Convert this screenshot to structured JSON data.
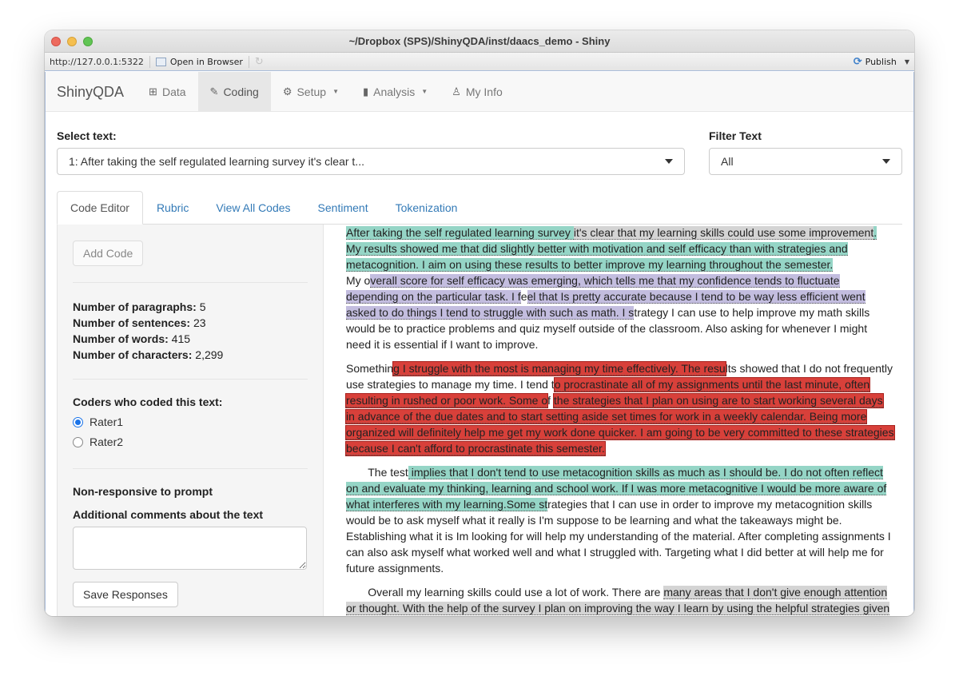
{
  "window": {
    "title": "~/Dropbox (SPS)/ShinyQDA/inst/daacs_demo - Shiny"
  },
  "rstudio_bar": {
    "url": "http://127.0.0.1:5322",
    "open_in_browser": "Open in Browser",
    "publish": "Publish"
  },
  "navbar": {
    "brand": "ShinyQDA",
    "items": [
      {
        "label": "Data",
        "icon": "table-icon",
        "glyph": "⊞"
      },
      {
        "label": "Coding",
        "icon": "edit-icon",
        "glyph": "✎",
        "active": true
      },
      {
        "label": "Setup",
        "icon": "gears-icon",
        "glyph": "⚙",
        "dropdown": true
      },
      {
        "label": "Analysis",
        "icon": "bar-chart-icon",
        "glyph": "▮",
        "dropdown": true
      },
      {
        "label": "My Info",
        "icon": "user-icon",
        "glyph": "♙"
      }
    ]
  },
  "select_text": {
    "label": "Select text:",
    "value": "1: After taking the self regulated learning survey it's clear t..."
  },
  "filter_text": {
    "label": "Filter Text",
    "value": "All"
  },
  "tabs": [
    "Code Editor",
    "Rubric",
    "View All Codes",
    "Sentiment",
    "Tokenization"
  ],
  "sidebar": {
    "add_code": "Add Code",
    "stats": [
      {
        "label": "Number of paragraphs:",
        "value": "5"
      },
      {
        "label": "Number of sentences:",
        "value": "23"
      },
      {
        "label": "Number of words:",
        "value": "415"
      },
      {
        "label": "Number of characters:",
        "value": "2,299"
      }
    ],
    "coders_label": "Coders who coded this text:",
    "coders": [
      {
        "label": "Rater1",
        "checked": true
      },
      {
        "label": "Rater2",
        "checked": false
      }
    ],
    "non_responsive": "Non-responsive to prompt",
    "comments_label": "Additional comments about the text",
    "comments_value": "",
    "save": "Save Responses"
  },
  "colors": {
    "teal": "#95d5c6",
    "purple": "#c3bddf",
    "red": "#d8403a",
    "gray": "#d4d4d4",
    "link": "#337ab7"
  },
  "document": {
    "paragraphs": [
      [
        {
          "t": "After taking the self regulated learning survey ",
          "c": "teal"
        },
        {
          "t": "it's clear that my learning skills could use some improvement",
          "c": "gray"
        },
        {
          "t": ". My results showed me that did slightly better with motivation and self efficacy than with strategies and metacognition. I aim on using these results to better improve my learning throughout the semester.",
          "c": "teal"
        },
        {
          "br": true
        },
        {
          "t": " My o"
        },
        {
          "t": "verall score for self efficacy was emerging, which tells me that my confidence tends to fluctuate depending on the particular task. I f",
          "c": "purple"
        },
        {
          "t": "e"
        },
        {
          "t": "el that Is pretty accurate because I tend to be way less efficient went asked to do things I tend to struggle with such as math. I s",
          "c": "purple"
        },
        {
          "t": "trategy I can use to help improve my math skills would be to practice problems and quiz myself outside of the classroom. Also asking for whenever I might need it is essential if I want to improve."
        }
      ],
      [
        {
          "t": " Somethin"
        },
        {
          "t": "g I struggle with the most is managing my time effectively. The resu",
          "c": "red"
        },
        {
          "t": "lts showed that I do not frequently use strategies to manage my time. I tend t"
        },
        {
          "t": "o procrastinate all of my assignments until the last minute, often resulting in rushed or poor work. Some o",
          "c": "red"
        },
        {
          "t": "f "
        },
        {
          "t": "the strategies that I plan on using are to start working several days in advance of the due dates and to start setting aside set times for work in a weekly calendar. Being more organized will definitely help me get my work done quicker. I am going to be very committed to these strategies because I can't afford to procrastinate this semester.",
          "c": "red"
        }
      ],
      [
        {
          "t": "       The test"
        },
        {
          "t": " implies that I don't tend to use metacognition skills as much as I should be. I do not often reflect on and evaluate my thinking, learning and school work. If I was more metacognitive I would be more aware of what interferes with my learning.Some st",
          "c": "teal"
        },
        {
          "t": "rategies that I can use in order to improve my metacognition skills would be to ask myself what it really is I'm suppose to be learning and what the takeaways might be. Establishing what it is Im looking for will help my understanding of the material. After completing assignments I can also ask myself what worked well and what I struggled with. Targeting what I did better at will help me for future assignments."
        }
      ],
      [
        {
          "t": "       Overall my learning skills could use a lot of work. There are "
        },
        {
          "t": "many areas that I don't give enough attention or thought. With the help of the survey I plan on improving the way I learn by using the helpful strategies given",
          "c": "gray"
        }
      ]
    ]
  }
}
